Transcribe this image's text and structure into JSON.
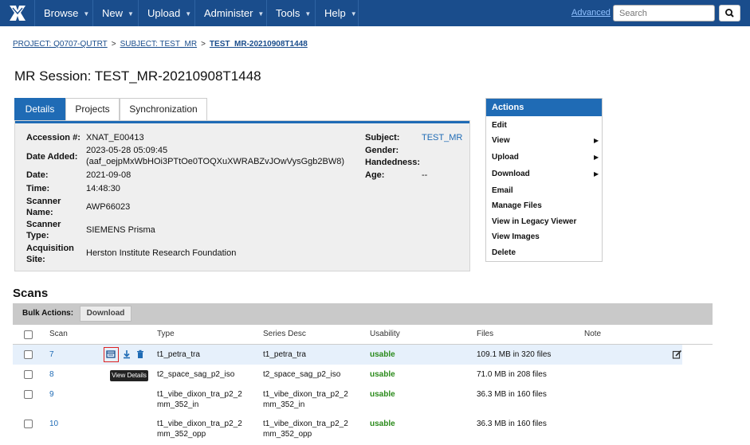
{
  "nav": {
    "items": [
      {
        "label": "Browse"
      },
      {
        "label": "New"
      },
      {
        "label": "Upload"
      },
      {
        "label": "Administer"
      },
      {
        "label": "Tools"
      },
      {
        "label": "Help"
      }
    ],
    "advanced_label": "Advanced",
    "search_placeholder": "Search",
    "logo_icon": "xnat-logo-icon",
    "search_icon": "search-icon"
  },
  "breadcrumb": {
    "project": "PROJECT: Q0707-QUTRT",
    "subject": "SUBJECT: TEST_MR",
    "current": "TEST_MR-20210908T1448",
    "separator": ">"
  },
  "page_title": "MR Session: TEST_MR-20210908T1448",
  "tabs": [
    {
      "label": "Details",
      "active": true
    },
    {
      "label": "Projects",
      "active": false
    },
    {
      "label": "Synchronization",
      "active": false
    }
  ],
  "details": {
    "accession_label": "Accession #:",
    "accession_value": "XNAT_E00413",
    "date_added_label": "Date Added:",
    "date_added_value": "2023-05-28 05:09:45",
    "date_added_user": "(aaf_oejpMxWbHOi3PTtOe0TOQXuXWRABZvJOwVysGgb2BW8)",
    "date_label": "Date:",
    "date_value": "2021-09-08",
    "time_label": "Time:",
    "time_value": "14:48:30",
    "scanner_name_label_1": "Scanner",
    "scanner_name_label_2": "Name:",
    "scanner_name_value": "AWP66023",
    "scanner_type_label_1": "Scanner",
    "scanner_type_label_2": "Type:",
    "scanner_type_value": "SIEMENS Prisma",
    "acq_site_label_1": "Acquisition",
    "acq_site_label_2": "Site:",
    "acq_site_value": "Herston Institute Research Foundation",
    "subject_label": "Subject:",
    "subject_value": "TEST_MR",
    "gender_label": "Gender:",
    "handedness_label": "Handedness:",
    "age_label": "Age:",
    "age_value": "--"
  },
  "actions": {
    "title": "Actions",
    "items": [
      {
        "label": "Edit",
        "submenu": false
      },
      {
        "label": "View",
        "submenu": true
      },
      {
        "label": "Upload",
        "submenu": true
      },
      {
        "label": "Download",
        "submenu": true
      },
      {
        "label": "Email",
        "submenu": false
      },
      {
        "label": "Manage Files",
        "submenu": false
      },
      {
        "label": "View in Legacy Viewer",
        "submenu": false
      },
      {
        "label": "View Images",
        "submenu": false
      },
      {
        "label": "Delete",
        "submenu": false
      }
    ]
  },
  "scans": {
    "title": "Scans",
    "bulk_label": "Bulk Actions:",
    "bulk_download": "Download",
    "headers": {
      "scan": "Scan",
      "type": "Type",
      "series_desc": "Series Desc",
      "usability": "Usability",
      "files": "Files",
      "note": "Note"
    },
    "tooltip": "View Details",
    "rows": [
      {
        "scan": "7",
        "type_1": "t1_petra_tra",
        "type_2": "",
        "series_1": "t1_petra_tra",
        "series_2": "",
        "usability": "usable",
        "files": "109.1 MB in 320 files"
      },
      {
        "scan": "8",
        "type_1": "t2_space_sag_p2_iso",
        "type_2": "",
        "series_1": "t2_space_sag_p2_iso",
        "series_2": "",
        "usability": "usable",
        "files": "71.0 MB in 208 files"
      },
      {
        "scan": "9",
        "type_1": "t1_vibe_dixon_tra_p2_2",
        "type_2": "mm_352_in",
        "series_1": "t1_vibe_dixon_tra_p2_2",
        "series_2": "mm_352_in",
        "usability": "usable",
        "files": "36.3 MB in 160 files"
      },
      {
        "scan": "10",
        "type_1": "t1_vibe_dixon_tra_p2_2",
        "type_2": "mm_352_opp",
        "series_1": "t1_vibe_dixon_tra_p2_2",
        "series_2": "mm_352_opp",
        "usability": "usable",
        "files": "36.3 MB in 160 files"
      }
    ]
  },
  "colors": {
    "nav_bg": "#1a4d8c",
    "accent": "#1f6bb5",
    "usable": "#2a8a1a"
  }
}
